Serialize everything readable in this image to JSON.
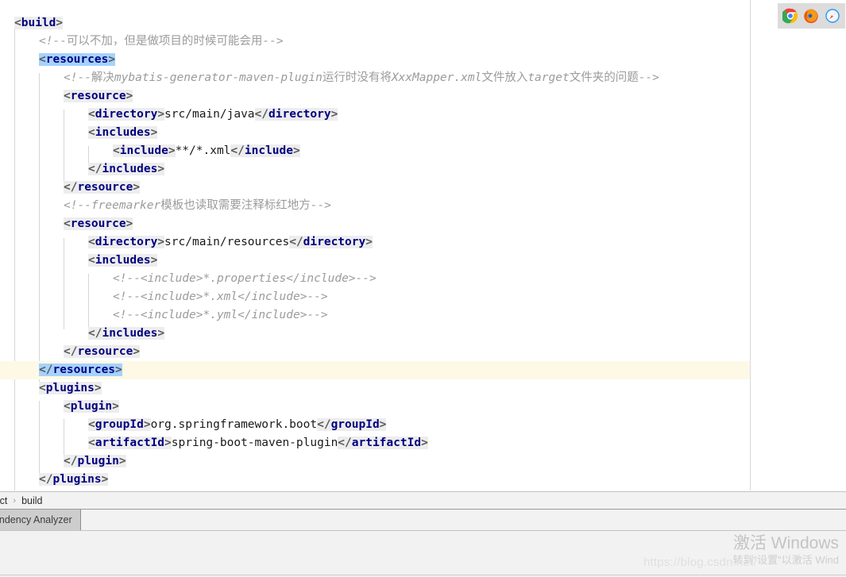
{
  "editor": {
    "lines": [
      {
        "indent": 0,
        "caret": false,
        "parts": [
          {
            "type": "tag",
            "text": "<build>",
            "selected": false
          }
        ]
      },
      {
        "indent": 2,
        "caret": false,
        "parts": [
          {
            "type": "comment",
            "text": "<!--可以不加，但是做项目的时候可能会用-->"
          }
        ]
      },
      {
        "indent": 2,
        "caret": false,
        "parts": [
          {
            "type": "tag",
            "text": "<resources>",
            "selected": true
          }
        ]
      },
      {
        "indent": 4,
        "caret": false,
        "parts": [
          {
            "type": "comment",
            "text": "<!--解决mybatis-generator-maven-plugin运行时没有将XxxMapper.xml文件放入target文件夹的问题-->"
          }
        ]
      },
      {
        "indent": 4,
        "caret": false,
        "parts": [
          {
            "type": "tag",
            "text": "<resource>",
            "selected": false
          }
        ]
      },
      {
        "indent": 6,
        "caret": false,
        "parts": [
          {
            "type": "tag",
            "text": "<directory>",
            "selected": false
          },
          {
            "type": "text",
            "text": "src/main/java"
          },
          {
            "type": "tag",
            "text": "</directory>",
            "selected": false
          }
        ]
      },
      {
        "indent": 6,
        "caret": false,
        "parts": [
          {
            "type": "tag",
            "text": "<includes>",
            "selected": false
          }
        ]
      },
      {
        "indent": 8,
        "caret": false,
        "parts": [
          {
            "type": "tag",
            "text": "<include>",
            "selected": false
          },
          {
            "type": "text",
            "text": "**/*.xml"
          },
          {
            "type": "tag",
            "text": "</include>",
            "selected": false
          }
        ]
      },
      {
        "indent": 6,
        "caret": false,
        "parts": [
          {
            "type": "tag",
            "text": "</includes>",
            "selected": false
          }
        ]
      },
      {
        "indent": 4,
        "caret": false,
        "parts": [
          {
            "type": "tag",
            "text": "</resource>",
            "selected": false
          }
        ]
      },
      {
        "indent": 4,
        "caret": false,
        "parts": [
          {
            "type": "comment",
            "text": "<!--freemarker模板也读取需要注释标红地方-->"
          }
        ]
      },
      {
        "indent": 4,
        "caret": false,
        "parts": [
          {
            "type": "tag",
            "text": "<resource>",
            "selected": false
          }
        ]
      },
      {
        "indent": 6,
        "caret": false,
        "parts": [
          {
            "type": "tag",
            "text": "<directory>",
            "selected": false
          },
          {
            "type": "text",
            "text": "src/main/resources"
          },
          {
            "type": "tag",
            "text": "</directory>",
            "selected": false
          }
        ]
      },
      {
        "indent": 6,
        "caret": false,
        "parts": [
          {
            "type": "tag",
            "text": "<includes>",
            "selected": false
          }
        ]
      },
      {
        "indent": 8,
        "caret": false,
        "parts": [
          {
            "type": "comment",
            "text": "<!--<include>*.properties</include>-->"
          }
        ]
      },
      {
        "indent": 8,
        "caret": false,
        "parts": [
          {
            "type": "comment",
            "text": "<!--<include>*.xml</include>-->"
          }
        ]
      },
      {
        "indent": 8,
        "caret": false,
        "parts": [
          {
            "type": "comment",
            "text": "<!--<include>*.yml</include>-->"
          }
        ]
      },
      {
        "indent": 6,
        "caret": false,
        "parts": [
          {
            "type": "tag",
            "text": "</includes>",
            "selected": false
          }
        ]
      },
      {
        "indent": 4,
        "caret": false,
        "parts": [
          {
            "type": "tag",
            "text": "</resource>",
            "selected": false
          }
        ]
      },
      {
        "indent": 2,
        "caret": true,
        "parts": [
          {
            "type": "tag",
            "text": "</resources>",
            "selected": true
          }
        ]
      },
      {
        "indent": 2,
        "caret": false,
        "parts": [
          {
            "type": "tag",
            "text": "<plugins>",
            "selected": false
          }
        ]
      },
      {
        "indent": 4,
        "caret": false,
        "parts": [
          {
            "type": "tag",
            "text": "<plugin>",
            "selected": false
          }
        ]
      },
      {
        "indent": 6,
        "caret": false,
        "parts": [
          {
            "type": "tag",
            "text": "<groupId>",
            "selected": false
          },
          {
            "type": "text",
            "text": "org.springframework.boot"
          },
          {
            "type": "tag",
            "text": "</groupId>",
            "selected": false
          }
        ]
      },
      {
        "indent": 6,
        "caret": false,
        "parts": [
          {
            "type": "tag",
            "text": "<artifactId>",
            "selected": false
          },
          {
            "type": "text",
            "text": "spring-boot-maven-plugin"
          },
          {
            "type": "tag",
            "text": "</artifactId>",
            "selected": false
          }
        ]
      },
      {
        "indent": 4,
        "caret": false,
        "parts": [
          {
            "type": "tag",
            "text": "</plugin>",
            "selected": false
          }
        ]
      },
      {
        "indent": 2,
        "caret": false,
        "parts": [
          {
            "type": "tag",
            "text": "</plugins>",
            "selected": false
          }
        ]
      }
    ],
    "colors": {
      "tag_name": "#000080",
      "tag_bracket": "#5a5a5a",
      "tag_background": "#ededed",
      "selection": "#a6d2ff",
      "caret_line": "#fdf9e6",
      "comment": "#9b9b9b",
      "text_value": "#1a1a1a",
      "right_margin_line": "#d9d9d9"
    }
  },
  "browser_bar": {
    "icons": [
      {
        "name": "chrome-icon",
        "label": "Chrome"
      },
      {
        "name": "firefox-icon",
        "label": "Firefox"
      },
      {
        "name": "safari-icon",
        "label": "Safari"
      }
    ]
  },
  "breadcrumb": {
    "items": [
      "oject",
      "build"
    ],
    "separator": "›"
  },
  "tool_window": {
    "active_tab": "pendency Analyzer"
  },
  "watermarks": {
    "windows_title": "激活 Windows",
    "windows_subtitle": "转到\"设置\"以激活 Wind",
    "blog_url": "https://blog.csdn.net/"
  }
}
